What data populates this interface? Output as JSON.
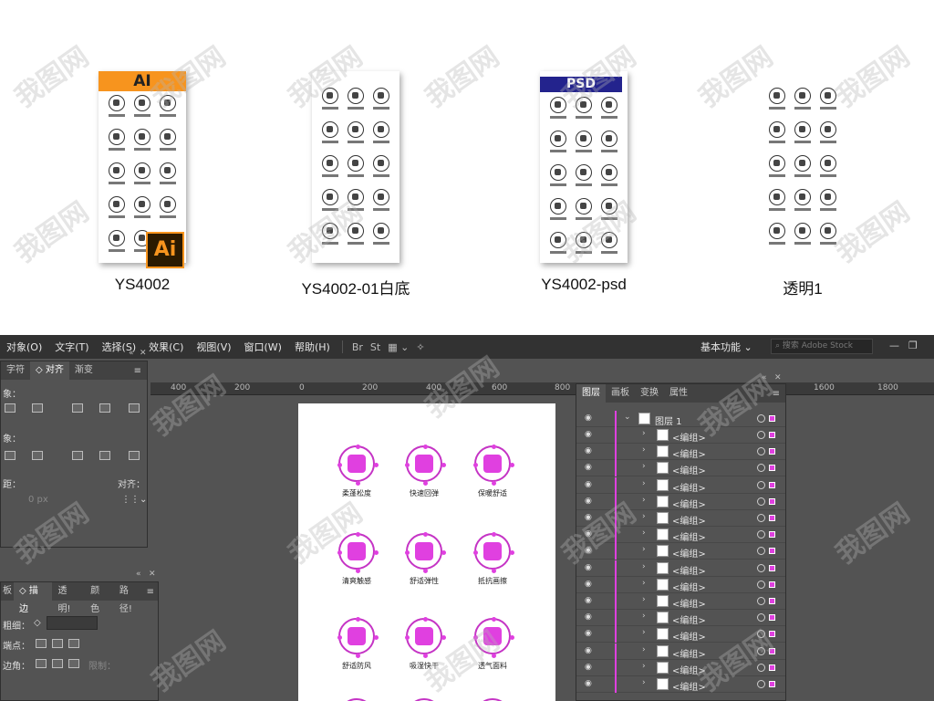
{
  "previews": [
    {
      "label": "YS4002",
      "badge": "AI",
      "badge_type": "ai",
      "has_ai_logo": true
    },
    {
      "label": "YS4002-01白底",
      "badge": "",
      "badge_type": "none",
      "has_ai_logo": false
    },
    {
      "label": "YS4002-psd",
      "badge": "PSD",
      "badge_type": "psd",
      "has_ai_logo": false
    },
    {
      "label": "透明1",
      "badge": "",
      "badge_type": "none",
      "has_ai_logo": false
    }
  ],
  "ai_logo_text": "Ai",
  "menubar": {
    "items": [
      "对象(O)",
      "文字(T)",
      "选择(S)",
      "效果(C)",
      "视图(V)",
      "窗口(W)",
      "帮助(H)"
    ],
    "bridge": "Br",
    "stock": "St",
    "workspace": "基本功能 ⌄",
    "search_placeholder": "搜索 Adobe Stock"
  },
  "ruler": {
    "labels": [
      "400",
      "200",
      "0",
      "200",
      "400",
      "600",
      "800",
      "1600",
      "1800"
    ]
  },
  "align_panel": {
    "tabs": [
      "字符",
      "◇ 对齐",
      "渐变"
    ],
    "align_objects_label": "象：",
    "distribute_label": "象：",
    "spacing_label": "距：",
    "align_to_label": "对齐：",
    "spacing_value": "0 px"
  },
  "stroke_panel": {
    "tabs": [
      "板",
      "◇ 描边",
      "透明!",
      "颜色",
      "路径!"
    ],
    "weight_label": "粗细：",
    "cap_label": "端点：",
    "corner_label": "边角：",
    "limit_label": "限制："
  },
  "artboard": {
    "icons": [
      {
        "label": "柔蓬松度"
      },
      {
        "label": "快速回弹"
      },
      {
        "label": "保暖舒适"
      },
      {
        "label": "清爽触感"
      },
      {
        "label": "舒适弹性"
      },
      {
        "label": "抵抗画擦"
      },
      {
        "label": "舒适防风"
      },
      {
        "label": "吸湿快干"
      },
      {
        "label": "透气面料"
      }
    ]
  },
  "layers_panel": {
    "tabs": [
      "图层",
      "画板",
      "变换",
      "属性"
    ],
    "top_layer": "图层 1",
    "group_name": "<编组>",
    "group_count": 16
  },
  "watermark": "我图网"
}
